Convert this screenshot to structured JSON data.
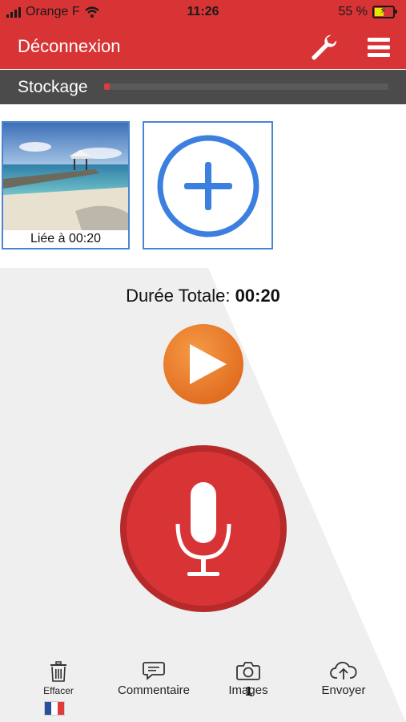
{
  "status_bar": {
    "carrier": "Orange F",
    "time": "11:26",
    "battery_percent": "55 %",
    "battery_level": 0.55
  },
  "header": {
    "logout_label": "Déconnexion",
    "settings_icon": "wrench-icon",
    "menu_icon": "hamburger-menu-icon"
  },
  "storage": {
    "label": "Stockage",
    "used_fraction": 0.02
  },
  "media": {
    "items": [
      {
        "caption": "Liée à 00:20",
        "icon": "beach-photo"
      }
    ],
    "add_icon": "add-circle-icon"
  },
  "player": {
    "duration_label": "Durée Totale:",
    "duration_value": "00:20",
    "play_icon": "play-icon",
    "record_icon": "microphone-icon"
  },
  "bottom_nav": {
    "items": [
      {
        "label": "Effacer",
        "icon": "trash-icon"
      },
      {
        "label": "Commentaire",
        "icon": "comment-icon"
      },
      {
        "label": "Images",
        "icon": "camera-icon",
        "badge": "1"
      },
      {
        "label": "Envoyer",
        "icon": "cloud-upload-icon"
      }
    ],
    "language_flag": "french-flag"
  },
  "colors": {
    "brand_red": "#d93435",
    "storage_gray": "#4b4b4b",
    "accent_blue": "#3b7fe0",
    "play_orange": "#ee7a2a"
  }
}
